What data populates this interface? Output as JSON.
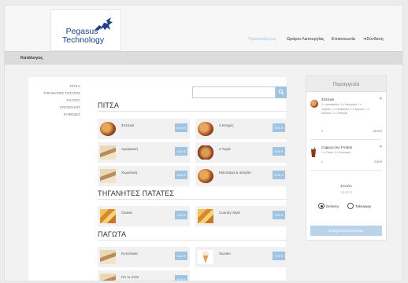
{
  "header": {
    "logo_line1": "Pegasus",
    "logo_line2": "Technology",
    "nav": {
      "home": "Τιμοκατάλογος",
      "hours": "Ωράριο Λειτουργίας",
      "contact": "Επικοινωνία",
      "login": "Σύνδεση"
    }
  },
  "breadcrumb": "Κατάλογος",
  "sidebar": {
    "items": [
      "ΠΙΤΣΑ",
      "ΤΗΓΑΝΗΤΕΣ ΠΑΤΑΤΕΣ",
      "ΠΑΓΩΤΑ",
      "CROISSANT",
      "ΚΑΦΕΔΕΣ"
    ]
  },
  "search": {
    "placeholder": ""
  },
  "sections": [
    {
      "title": "ΠΙΤΣΑ",
      "items": [
        {
          "name": "Σπέσιαλ",
          "price": "12,00 €",
          "thumb": "pizza"
        },
        {
          "name": "4 Εποχές",
          "price": "8,00 €",
          "thumb": "pizza"
        },
        {
          "name": "Αμερικανή",
          "price": "8,00 €",
          "thumb": "crepe"
        },
        {
          "name": "4 Τυριά",
          "price": "8,00 €",
          "thumb": "pizza-plate"
        },
        {
          "name": "Χωριάτικη",
          "price": "8,00 €",
          "thumb": "crepe"
        },
        {
          "name": "Μανιτάρια & σκόρδο",
          "price": "8,00 €",
          "thumb": "pizza"
        }
      ]
    },
    {
      "title": "ΤΗΓΑΝΗΤΕΣ ΠΑΤΑΤΕΣ",
      "items": [
        {
          "name": "Classic",
          "price": "3,00 €",
          "thumb": "fries"
        },
        {
          "name": "Country Style",
          "price": "3,00 €",
          "thumb": "fries"
        }
      ]
    },
    {
      "title": "ΠΑΓΩΤΑ",
      "items": [
        {
          "name": "Κυπελλάκι",
          "price": "3,00 €",
          "thumb": "icecream-cup"
        },
        {
          "name": "Χωνάκι",
          "price": "3,00 €",
          "thumb": "icecream-cone"
        },
        {
          "name": "Για το σπίτι",
          "price": "8,00 €",
          "thumb": "icecream-cup"
        }
      ]
    }
  ],
  "order": {
    "title": "Παραγγελία",
    "items": [
      {
        "name": "Σπέσιαλ",
        "desc": "1 x μοτσαρέλα, 1 x Κασεράκι, 1 x Τομάτα, 1 x Λουκάνικο, 1 x Ζαμπόν, 1 x Μπέικον, 1 x Πιπεριά",
        "qty": "1",
        "price": "13,00 €"
      },
      {
        "name": "Cappuccino Freddo",
        "desc": "1 x Γλυκό, 1 x Κανονική",
        "qty": "1",
        "price": "2,50 €"
      }
    ],
    "total_label": "Σύνολο",
    "total_value": "15,50 €",
    "delivery_label": "Delivery",
    "takeaway_label": "Takeaway",
    "delivery_selected": true,
    "complete_label": "Συνέχεια Παραγγελίας"
  },
  "colors": {
    "accent": "#9fc3e1",
    "brand": "#1f3f86"
  }
}
